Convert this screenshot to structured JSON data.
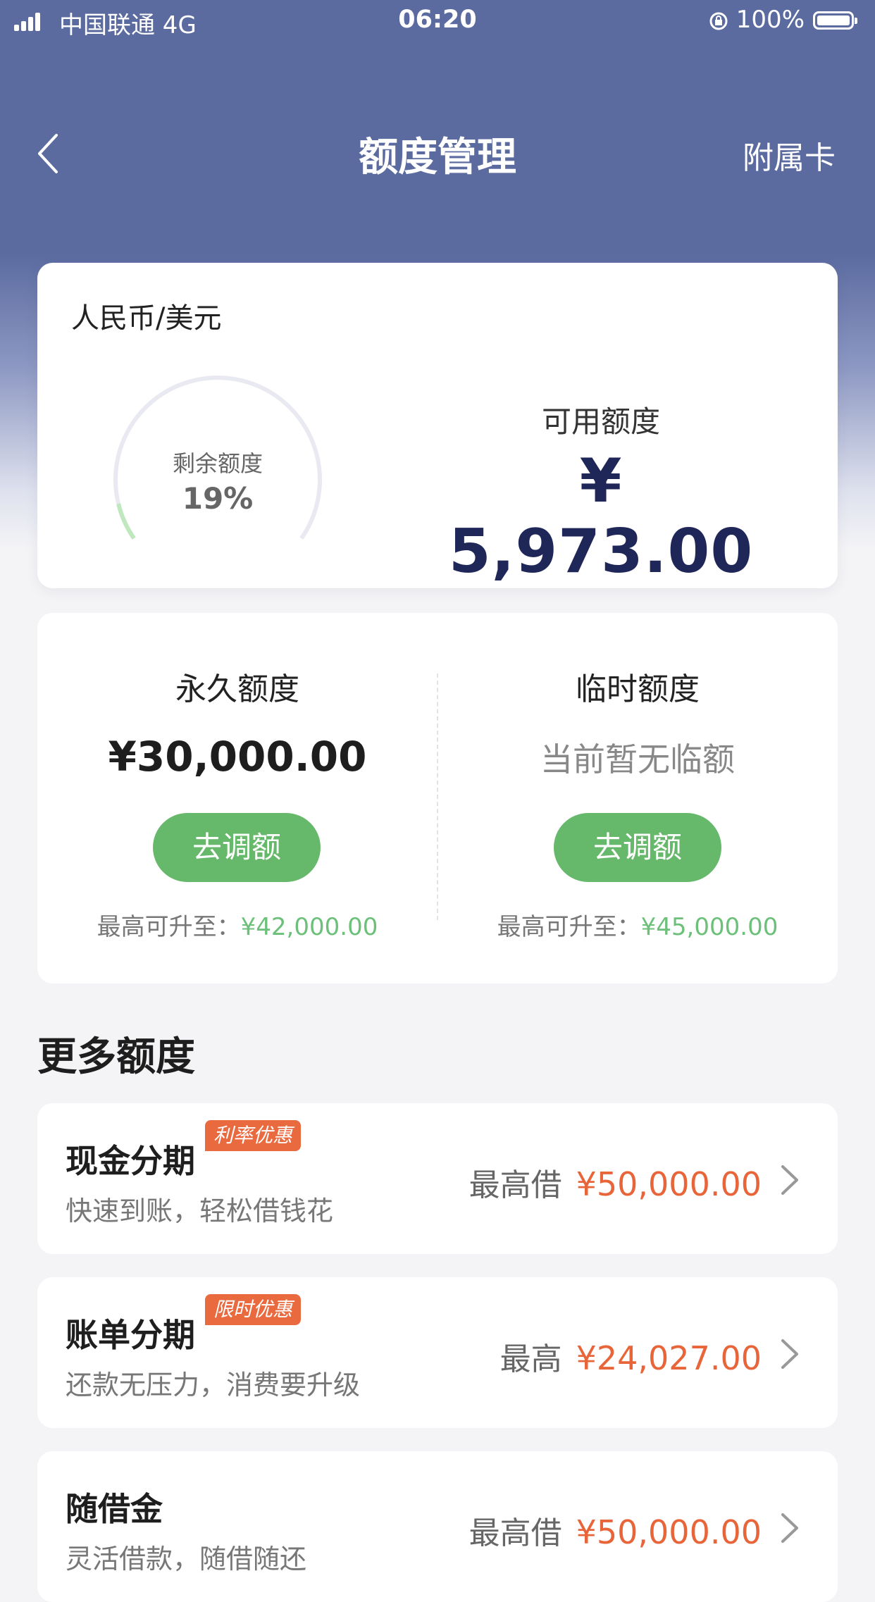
{
  "status_bar": {
    "carrier": "中国联通  4G",
    "time": "06:20",
    "battery": "100%"
  },
  "nav": {
    "title": "额度管理",
    "right_action": "附属卡"
  },
  "summary": {
    "currency": "人民币/美元",
    "gauge_label": "剩余额度",
    "gauge_value": "19%",
    "gauge_fraction": 0.19,
    "available_label": "可用额度",
    "available_amount": "¥ 5,973.00"
  },
  "limits": {
    "permanent": {
      "title": "永久额度",
      "amount": "¥30,000.00",
      "button": "去调额",
      "max_prefix": "最高可升至：",
      "max_value": "¥42,000.00"
    },
    "temporary": {
      "title": "临时额度",
      "empty_text": "当前暂无临额",
      "button": "去调额",
      "max_prefix": "最高可升至：",
      "max_value": "¥45,000.00"
    }
  },
  "more": {
    "title": "更多额度",
    "items": [
      {
        "title": "现金分期",
        "badge": "利率优惠",
        "subtitle": "快速到账，轻松借钱花",
        "right_label": "最高借",
        "amount": "¥50,000.00"
      },
      {
        "title": "账单分期",
        "badge": "限时优惠",
        "subtitle": "还款无压力，消费要升级",
        "right_label": "最高",
        "amount": "¥24,027.00"
      },
      {
        "title": "随借金",
        "badge": "",
        "subtitle": "灵活借款，随借随还",
        "right_label": "最高借",
        "amount": "¥50,000.00"
      }
    ]
  },
  "colors": {
    "header": "#5b6ba0",
    "accent_green": "#66b86a",
    "amount_orange": "#e8653a",
    "amount_navy": "#1f2658"
  }
}
